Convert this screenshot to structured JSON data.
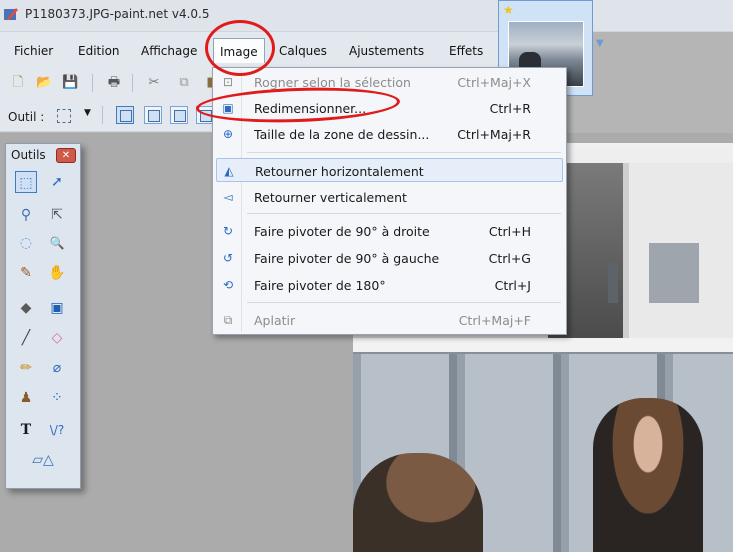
{
  "window": {
    "title": "P1180373.JPG-paint.net v4.0.5",
    "thumbnail_star": "★"
  },
  "menubar": {
    "items": [
      {
        "label": "Fichier"
      },
      {
        "label": "Edition"
      },
      {
        "label": "Affichage"
      },
      {
        "label": "Image",
        "active": true
      },
      {
        "label": "Calques"
      },
      {
        "label": "Ajustements"
      },
      {
        "label": "Effets"
      }
    ]
  },
  "toolbar": {
    "outil_label": "Outil :",
    "icons": [
      "new-icon",
      "open-icon",
      "save-icon",
      "print-icon",
      "cut-icon",
      "copy-icon"
    ]
  },
  "tools_panel": {
    "title": "Outils",
    "close_glyph": "✕",
    "tools": [
      {
        "name": "rectangle-select-tool",
        "glyph": "⬚",
        "selected": true
      },
      {
        "name": "move-selected-pixels-tool",
        "glyph": "➚"
      },
      {
        "name": "lasso-select-tool",
        "glyph": "⚲"
      },
      {
        "name": "move-selection-tool",
        "glyph": "⇱"
      },
      {
        "name": "ellipse-select-tool",
        "glyph": "◌"
      },
      {
        "name": "zoom-tool",
        "glyph": "🔍"
      },
      {
        "name": "magic-wand-tool",
        "glyph": "✎"
      },
      {
        "name": "pan-tool",
        "glyph": "✋"
      },
      {
        "name": "paint-bucket-tool",
        "glyph": "◆"
      },
      {
        "name": "gradient-tool",
        "glyph": "▣"
      },
      {
        "name": "paintbrush-tool",
        "glyph": "╱"
      },
      {
        "name": "eraser-tool",
        "glyph": "◇"
      },
      {
        "name": "pencil-tool",
        "glyph": "✏"
      },
      {
        "name": "color-picker-tool",
        "glyph": "⌀"
      },
      {
        "name": "clone-stamp-tool",
        "glyph": "♟"
      },
      {
        "name": "recolor-tool",
        "glyph": "⁘"
      },
      {
        "name": "text-tool",
        "glyph": "T"
      },
      {
        "name": "line-curve-tool",
        "glyph": "\\/?"
      },
      {
        "name": "shapes-tool",
        "glyph": "▱△"
      }
    ]
  },
  "image_menu": {
    "items": [
      {
        "label": "Rogner selon la sélection",
        "shortcut": "Ctrl+Maj+X",
        "icon": "crop-icon",
        "glyph": "⊡",
        "disabled": true
      },
      {
        "label": "Redimensionner...",
        "shortcut": "Ctrl+R",
        "icon": "resize-icon",
        "glyph": "▣"
      },
      {
        "label": "Taille de la zone de dessin...",
        "shortcut": "Ctrl+Maj+R",
        "icon": "canvas-size-icon",
        "glyph": "⊕"
      },
      {
        "label": "Retourner horizontalement",
        "shortcut": "",
        "icon": "flip-horizontal-icon",
        "glyph": "◭",
        "hover": true
      },
      {
        "label": "Retourner verticalement",
        "shortcut": "",
        "icon": "flip-vertical-icon",
        "glyph": "◅"
      },
      {
        "label": "Faire pivoter de 90° à droite",
        "shortcut": "Ctrl+H",
        "icon": "rotate-right-icon",
        "glyph": "↻"
      },
      {
        "label": "Faire pivoter de 90° à gauche",
        "shortcut": "Ctrl+G",
        "icon": "rotate-left-icon",
        "glyph": "↺"
      },
      {
        "label": "Faire pivoter de 180°",
        "shortcut": "Ctrl+J",
        "icon": "rotate-180-icon",
        "glyph": "⟲"
      },
      {
        "label": "Aplatir",
        "shortcut": "Ctrl+Maj+F",
        "icon": "flatten-icon",
        "glyph": "⧉",
        "disabled": true
      }
    ]
  },
  "annotation_color": "#e01b1b",
  "accent_color": "#3d7bc7"
}
